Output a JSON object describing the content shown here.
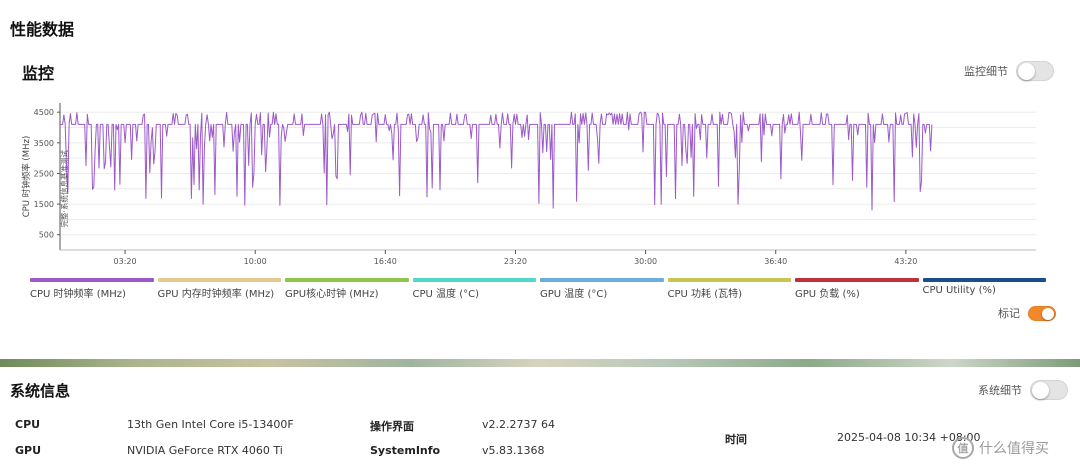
{
  "page": {
    "title": "性能数据"
  },
  "monitor": {
    "title": "监控",
    "detail_toggle_label": "监控细节",
    "mark_toggle_label": "标记"
  },
  "legend": [
    {
      "label": "CPU 时钟频率 (MHz)",
      "color": "#9b59c9"
    },
    {
      "label": "GPU 内存时钟频率 (MHz)",
      "color": "#e6c98f"
    },
    {
      "label": "GPU核心时钟 (MHz)",
      "color": "#8fc44a"
    },
    {
      "label": "CPU 温度 (°C)",
      "color": "#4fd9c0"
    },
    {
      "label": "GPU 温度 (°C)",
      "color": "#6aaee0"
    },
    {
      "label": "CPU 功耗 (瓦特)",
      "color": "#c9c456"
    },
    {
      "label": "GPU 负载 (%)",
      "color": "#c0303a"
    },
    {
      "label": "CPU Utility (%)",
      "color": "#1b4f8a"
    }
  ],
  "chart_data": {
    "type": "line",
    "ylabel": "CPU 时钟频率 (MHz)",
    "annotation": "完整·系统信息基准测试",
    "ylim": [
      0,
      4800
    ],
    "yticks": [
      500,
      1500,
      2500,
      3500,
      4500
    ],
    "xlim": [
      0,
      3000
    ],
    "xticks": [
      200,
      600,
      1000,
      1400,
      1800,
      2200,
      2600
    ],
    "xtick_labels": [
      "03:20",
      "10:00",
      "16:40",
      "23:20",
      "30:00",
      "36:40",
      "43:20"
    ],
    "series": [
      {
        "name": "CPU 时钟频率 (MHz)",
        "color": "#9b59c9",
        "baseline": 4100,
        "peak": 4500,
        "duration_s": 2680
      }
    ]
  },
  "system": {
    "title": "系统信息",
    "detail_toggle_label": "系统细节",
    "rows": [
      {
        "label": "CPU",
        "value": "13th Gen Intel Core i5-13400F"
      },
      {
        "label": "GPU",
        "value": "NVIDIA GeForce RTX 4060 Ti"
      },
      {
        "label": "操作界面",
        "value": "v2.2.2737 64"
      },
      {
        "label": "SystemInfo",
        "value": "v5.83.1368"
      },
      {
        "label": "时间",
        "value": "2025-04-08 10:34 +08:00"
      }
    ]
  },
  "watermark": {
    "logo": "值",
    "text": "什么值得买"
  }
}
